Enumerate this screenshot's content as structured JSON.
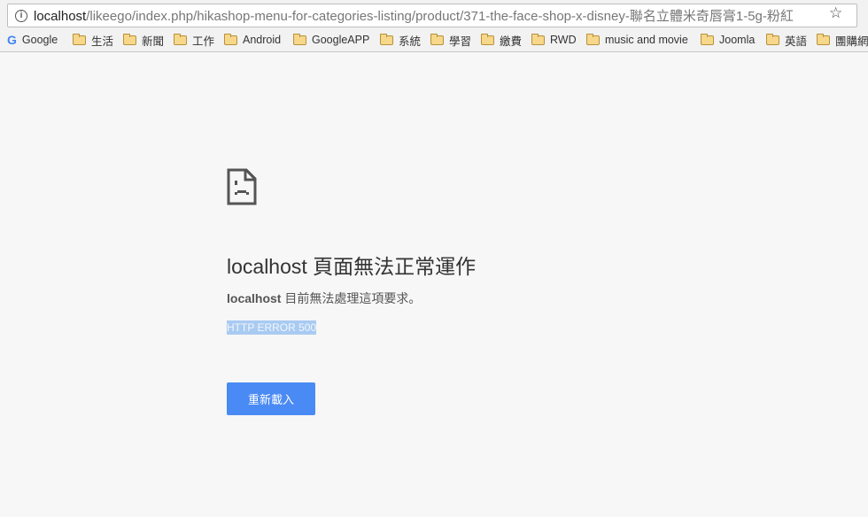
{
  "browser": {
    "url_host": "localhost",
    "url_path": "/likeego/index.php/hikashop-menu-for-categories-listing/product/371-the-face-shop-x-disney-聯名立體米奇唇膏1-5g-粉紅",
    "bookmarks": [
      {
        "label": "Google",
        "icon": "google-icon"
      },
      {
        "label": "生活",
        "icon": "folder-icon"
      },
      {
        "label": "新聞",
        "icon": "folder-icon"
      },
      {
        "label": "工作",
        "icon": "folder-icon"
      },
      {
        "label": "Android",
        "icon": "folder-icon"
      },
      {
        "label": "GoogleAPP",
        "icon": "folder-icon"
      },
      {
        "label": "系統",
        "icon": "folder-icon"
      },
      {
        "label": "學習",
        "icon": "folder-icon"
      },
      {
        "label": "繳費",
        "icon": "folder-icon"
      },
      {
        "label": "RWD",
        "icon": "folder-icon"
      },
      {
        "label": "music and movie",
        "icon": "folder-icon"
      },
      {
        "label": "Joomla",
        "icon": "folder-icon"
      },
      {
        "label": "英語",
        "icon": "folder-icon"
      },
      {
        "label": "團購網",
        "icon": "folder-icon"
      }
    ]
  },
  "error_page": {
    "title_host": "localhost",
    "title_rest": " 頁面無法正常運作",
    "message_host": "localhost",
    "message_rest": " 目前無法處理這項要求。",
    "error_code": "HTTP ERROR 500",
    "reload_label": "重新載入",
    "accent_color": "#4a8af4"
  }
}
